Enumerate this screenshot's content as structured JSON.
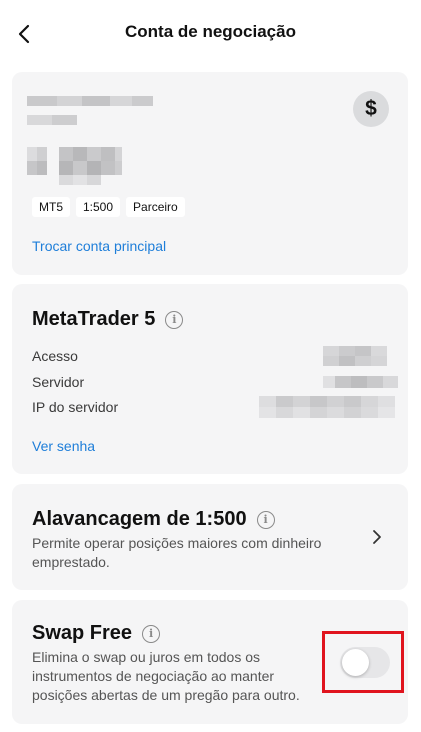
{
  "header": {
    "title": "Conta de negociação",
    "back_icon": "chevron-left-icon"
  },
  "account_card": {
    "currency_icon": "dollar-icon",
    "tags": [
      "MT5",
      "1:500",
      "Parceiro"
    ],
    "switch_link": "Trocar conta principal"
  },
  "mt5_card": {
    "title": "MetaTrader 5",
    "rows": [
      {
        "label": "Acesso"
      },
      {
        "label": "Servidor"
      },
      {
        "label": "IP do servidor"
      }
    ],
    "password_link": "Ver senha"
  },
  "leverage_card": {
    "title": "Alavancagem de 1:500",
    "description": "Permite operar posições maiores com dinheiro emprestado."
  },
  "swap_card": {
    "title": "Swap Free",
    "description": "Elimina o swap ou juros em todos os instrumentos de negociação ao manter posições abertas de um pregão para outro.",
    "toggle_on": false
  },
  "colors": {
    "card_bg": "#f5f5f6",
    "link": "#1e7ed9",
    "highlight": "#e0141e"
  }
}
